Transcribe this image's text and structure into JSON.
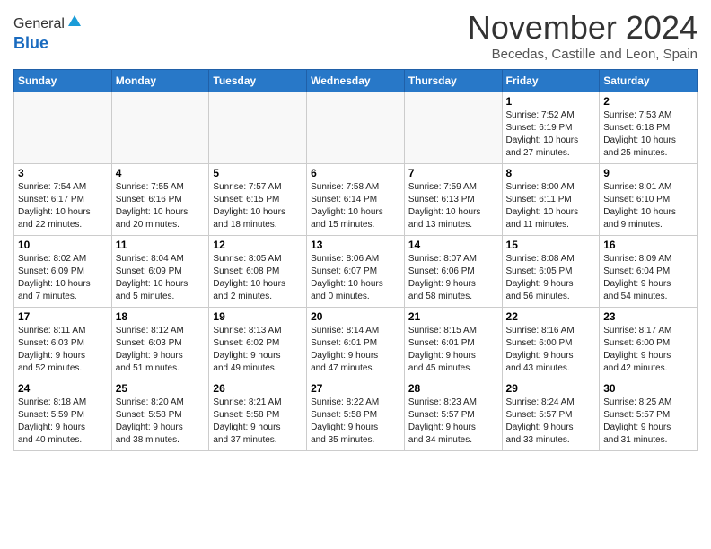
{
  "header": {
    "logo_general": "General",
    "logo_blue": "Blue",
    "month_title": "November 2024",
    "location": "Becedas, Castille and Leon, Spain"
  },
  "days_of_week": [
    "Sunday",
    "Monday",
    "Tuesday",
    "Wednesday",
    "Thursday",
    "Friday",
    "Saturday"
  ],
  "weeks": [
    [
      {
        "day": "",
        "info": ""
      },
      {
        "day": "",
        "info": ""
      },
      {
        "day": "",
        "info": ""
      },
      {
        "day": "",
        "info": ""
      },
      {
        "day": "",
        "info": ""
      },
      {
        "day": "1",
        "info": "Sunrise: 7:52 AM\nSunset: 6:19 PM\nDaylight: 10 hours\nand 27 minutes."
      },
      {
        "day": "2",
        "info": "Sunrise: 7:53 AM\nSunset: 6:18 PM\nDaylight: 10 hours\nand 25 minutes."
      }
    ],
    [
      {
        "day": "3",
        "info": "Sunrise: 7:54 AM\nSunset: 6:17 PM\nDaylight: 10 hours\nand 22 minutes."
      },
      {
        "day": "4",
        "info": "Sunrise: 7:55 AM\nSunset: 6:16 PM\nDaylight: 10 hours\nand 20 minutes."
      },
      {
        "day": "5",
        "info": "Sunrise: 7:57 AM\nSunset: 6:15 PM\nDaylight: 10 hours\nand 18 minutes."
      },
      {
        "day": "6",
        "info": "Sunrise: 7:58 AM\nSunset: 6:14 PM\nDaylight: 10 hours\nand 15 minutes."
      },
      {
        "day": "7",
        "info": "Sunrise: 7:59 AM\nSunset: 6:13 PM\nDaylight: 10 hours\nand 13 minutes."
      },
      {
        "day": "8",
        "info": "Sunrise: 8:00 AM\nSunset: 6:11 PM\nDaylight: 10 hours\nand 11 minutes."
      },
      {
        "day": "9",
        "info": "Sunrise: 8:01 AM\nSunset: 6:10 PM\nDaylight: 10 hours\nand 9 minutes."
      }
    ],
    [
      {
        "day": "10",
        "info": "Sunrise: 8:02 AM\nSunset: 6:09 PM\nDaylight: 10 hours\nand 7 minutes."
      },
      {
        "day": "11",
        "info": "Sunrise: 8:04 AM\nSunset: 6:09 PM\nDaylight: 10 hours\nand 5 minutes."
      },
      {
        "day": "12",
        "info": "Sunrise: 8:05 AM\nSunset: 6:08 PM\nDaylight: 10 hours\nand 2 minutes."
      },
      {
        "day": "13",
        "info": "Sunrise: 8:06 AM\nSunset: 6:07 PM\nDaylight: 10 hours\nand 0 minutes."
      },
      {
        "day": "14",
        "info": "Sunrise: 8:07 AM\nSunset: 6:06 PM\nDaylight: 9 hours\nand 58 minutes."
      },
      {
        "day": "15",
        "info": "Sunrise: 8:08 AM\nSunset: 6:05 PM\nDaylight: 9 hours\nand 56 minutes."
      },
      {
        "day": "16",
        "info": "Sunrise: 8:09 AM\nSunset: 6:04 PM\nDaylight: 9 hours\nand 54 minutes."
      }
    ],
    [
      {
        "day": "17",
        "info": "Sunrise: 8:11 AM\nSunset: 6:03 PM\nDaylight: 9 hours\nand 52 minutes."
      },
      {
        "day": "18",
        "info": "Sunrise: 8:12 AM\nSunset: 6:03 PM\nDaylight: 9 hours\nand 51 minutes."
      },
      {
        "day": "19",
        "info": "Sunrise: 8:13 AM\nSunset: 6:02 PM\nDaylight: 9 hours\nand 49 minutes."
      },
      {
        "day": "20",
        "info": "Sunrise: 8:14 AM\nSunset: 6:01 PM\nDaylight: 9 hours\nand 47 minutes."
      },
      {
        "day": "21",
        "info": "Sunrise: 8:15 AM\nSunset: 6:01 PM\nDaylight: 9 hours\nand 45 minutes."
      },
      {
        "day": "22",
        "info": "Sunrise: 8:16 AM\nSunset: 6:00 PM\nDaylight: 9 hours\nand 43 minutes."
      },
      {
        "day": "23",
        "info": "Sunrise: 8:17 AM\nSunset: 6:00 PM\nDaylight: 9 hours\nand 42 minutes."
      }
    ],
    [
      {
        "day": "24",
        "info": "Sunrise: 8:18 AM\nSunset: 5:59 PM\nDaylight: 9 hours\nand 40 minutes."
      },
      {
        "day": "25",
        "info": "Sunrise: 8:20 AM\nSunset: 5:58 PM\nDaylight: 9 hours\nand 38 minutes."
      },
      {
        "day": "26",
        "info": "Sunrise: 8:21 AM\nSunset: 5:58 PM\nDaylight: 9 hours\nand 37 minutes."
      },
      {
        "day": "27",
        "info": "Sunrise: 8:22 AM\nSunset: 5:58 PM\nDaylight: 9 hours\nand 35 minutes."
      },
      {
        "day": "28",
        "info": "Sunrise: 8:23 AM\nSunset: 5:57 PM\nDaylight: 9 hours\nand 34 minutes."
      },
      {
        "day": "29",
        "info": "Sunrise: 8:24 AM\nSunset: 5:57 PM\nDaylight: 9 hours\nand 33 minutes."
      },
      {
        "day": "30",
        "info": "Sunrise: 8:25 AM\nSunset: 5:57 PM\nDaylight: 9 hours\nand 31 minutes."
      }
    ]
  ]
}
